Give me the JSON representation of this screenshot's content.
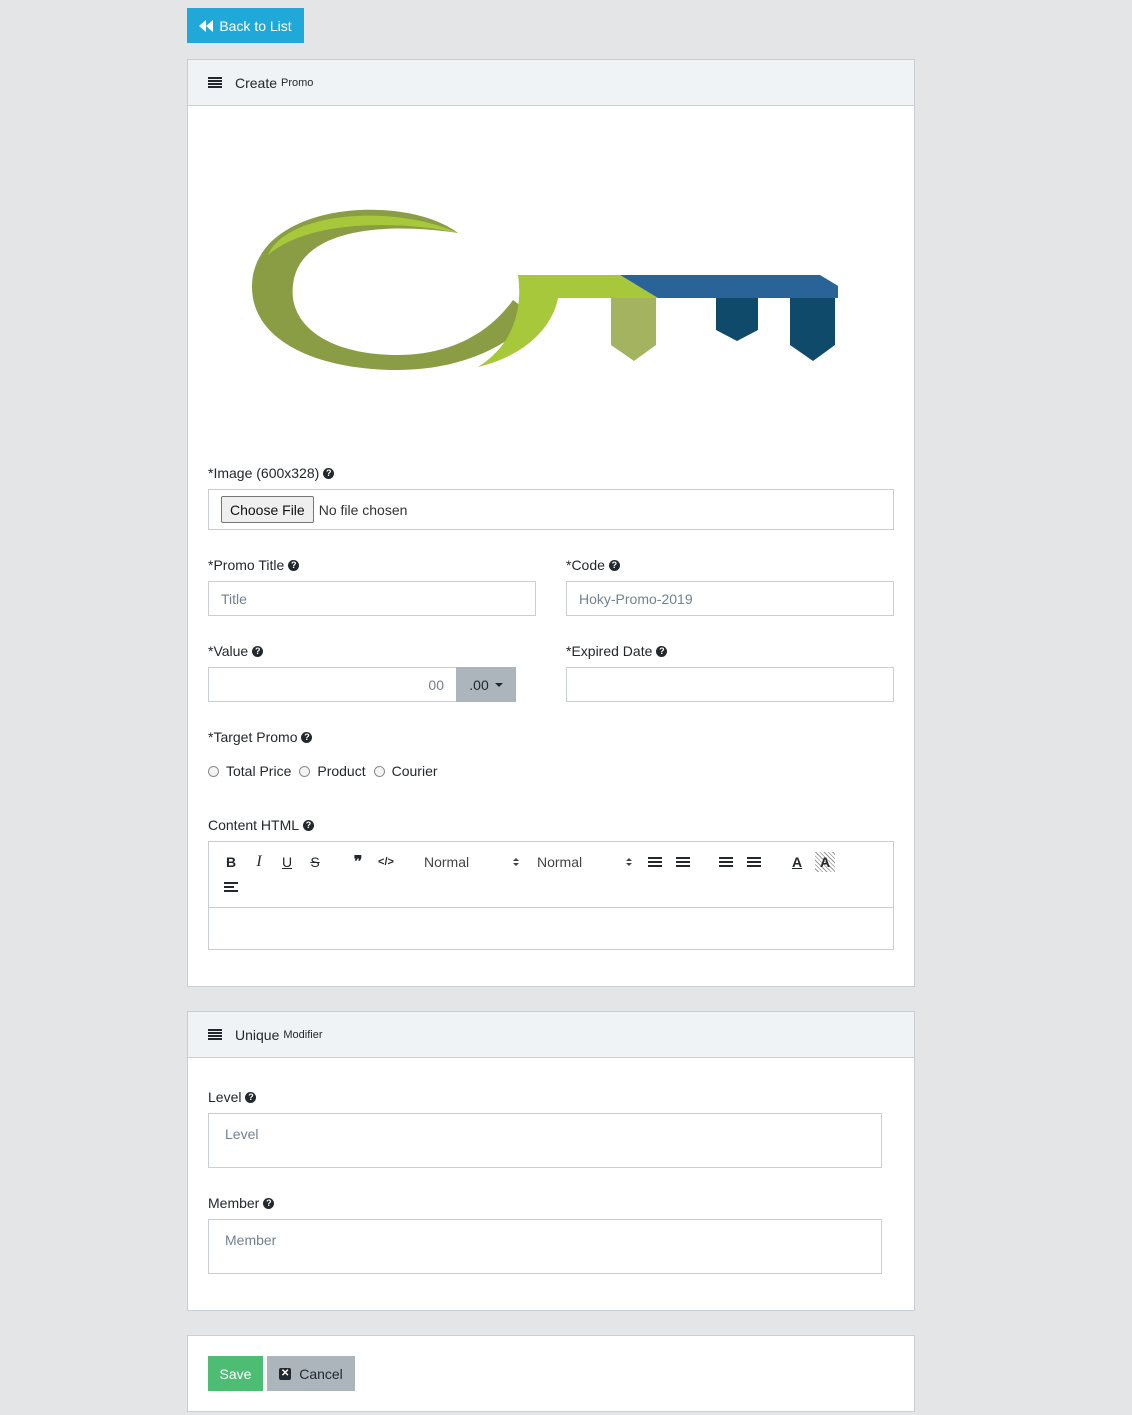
{
  "back_button": {
    "label": "Back to List"
  },
  "create_card": {
    "title": "Create",
    "subtitle": "Promo",
    "image_label": "*Image (600x328)",
    "file_button": "Choose File",
    "file_status": "No file chosen",
    "promo_title_label": "*Promo Title",
    "promo_title_placeholder": "Title",
    "code_label": "*Code",
    "code_placeholder": "Hoky-Promo-2019",
    "value_label": "*Value",
    "value_placeholder": "00",
    "value_addon": ".00",
    "expired_label": "*Expired Date",
    "expired_value": "",
    "target_label": "*Target Promo",
    "target_options": [
      "Total Price",
      "Product",
      "Courier"
    ],
    "content_label": "Content HTML",
    "editor": {
      "header_select": "Normal",
      "size_select": "Normal"
    }
  },
  "modifier_card": {
    "title": "Unique",
    "subtitle": "Modifier",
    "level_label": "Level",
    "level_placeholder": "Level",
    "member_label": "Member",
    "member_placeholder": "Member"
  },
  "actions": {
    "save_label": "Save",
    "cancel_label": "Cancel"
  },
  "colors": {
    "primary": "#20a8d8",
    "success": "#4dbd74",
    "secondary": "#acb4bc",
    "logo_green_dark": "#8a9d45",
    "logo_green_light": "#a8c83b",
    "logo_blue": "#2a6496",
    "logo_navy": "#0f4a6b"
  }
}
